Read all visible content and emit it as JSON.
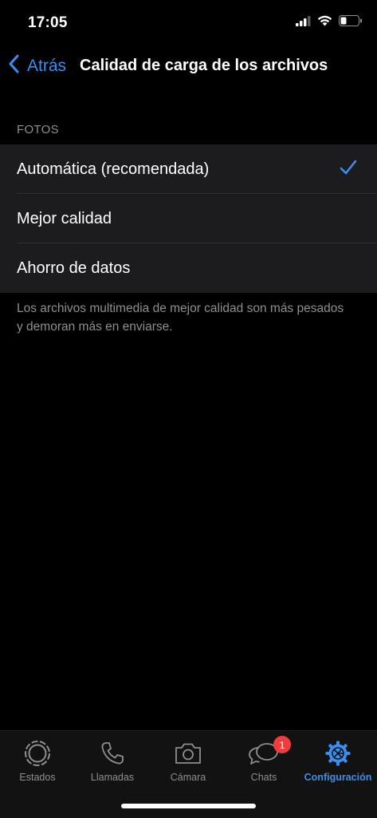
{
  "status_bar": {
    "time": "17:05",
    "icons": [
      "signal-icon",
      "wifi-icon",
      "battery-icon"
    ]
  },
  "nav": {
    "back_label": "Atrás",
    "title": "Calidad de carga de los archivos"
  },
  "section": {
    "header": "FOTOS",
    "options": [
      {
        "label": "Automática (recomendada)",
        "selected": true
      },
      {
        "label": "Mejor calidad",
        "selected": false
      },
      {
        "label": "Ahorro de datos",
        "selected": false
      }
    ],
    "footer": "Los archivos multimedia de mejor calidad son más pesados y demoran más en enviarse."
  },
  "tab_bar": {
    "tabs": [
      {
        "label": "Estados",
        "icon": "status-ring-icon",
        "active": false
      },
      {
        "label": "Llamadas",
        "icon": "phone-icon",
        "active": false
      },
      {
        "label": "Cámara",
        "icon": "camera-icon",
        "active": false
      },
      {
        "label": "Chats",
        "icon": "chat-bubbles-icon",
        "active": false,
        "badge": "1"
      },
      {
        "label": "Configuración",
        "icon": "gear-icon",
        "active": true
      }
    ]
  },
  "colors": {
    "accent": "#3b8ff0",
    "background": "#000000",
    "cell_background": "#1c1c1e",
    "secondary_text": "#8e8e93",
    "badge": "#f23c3c"
  }
}
